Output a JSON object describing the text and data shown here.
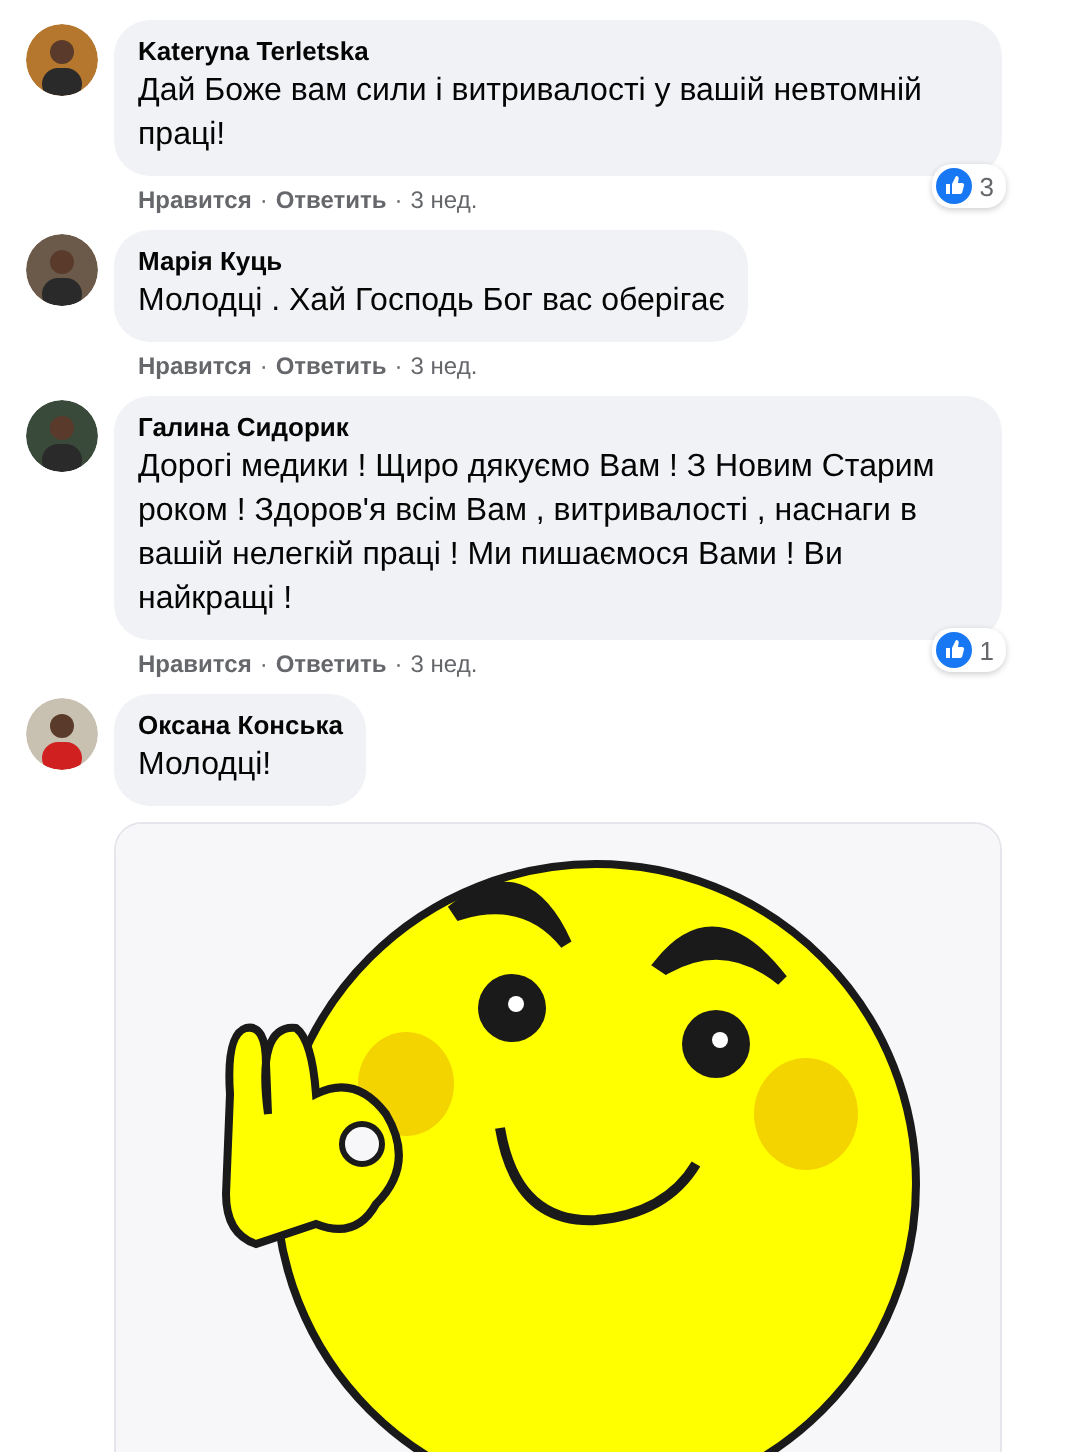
{
  "comments": [
    {
      "author": "Kateryna Terletska",
      "text": "Дай Боже вам сили і витривалості у вашій невтомній праці!",
      "reactions": "3",
      "actions": [
        "Нравится",
        "Ответить"
      ],
      "separator": "·",
      "time": "3 нед."
    },
    {
      "author": "Марія Куць",
      "text": "Молодці . Хай Господь Бог вас оберігає",
      "actions": [
        "Нравится",
        "Ответить"
      ],
      "separator": "·",
      "time": "3 нед."
    },
    {
      "author": "Галина Сидорик",
      "text": "Дорогі медики ! Щиро дякуємо Вам ! З Новим Старим роком ! Здоров'я всім Вам , витривалості , наснаги в вашій нелегкій праці ! Ми пишаємося Вами ! Ви найкращі !",
      "reactions": "1",
      "actions": [
        "Нравится",
        "Ответить"
      ],
      "separator": "·",
      "time": "3 нед."
    },
    {
      "author": "Оксана Конська",
      "text": "Молодці!"
    }
  ]
}
